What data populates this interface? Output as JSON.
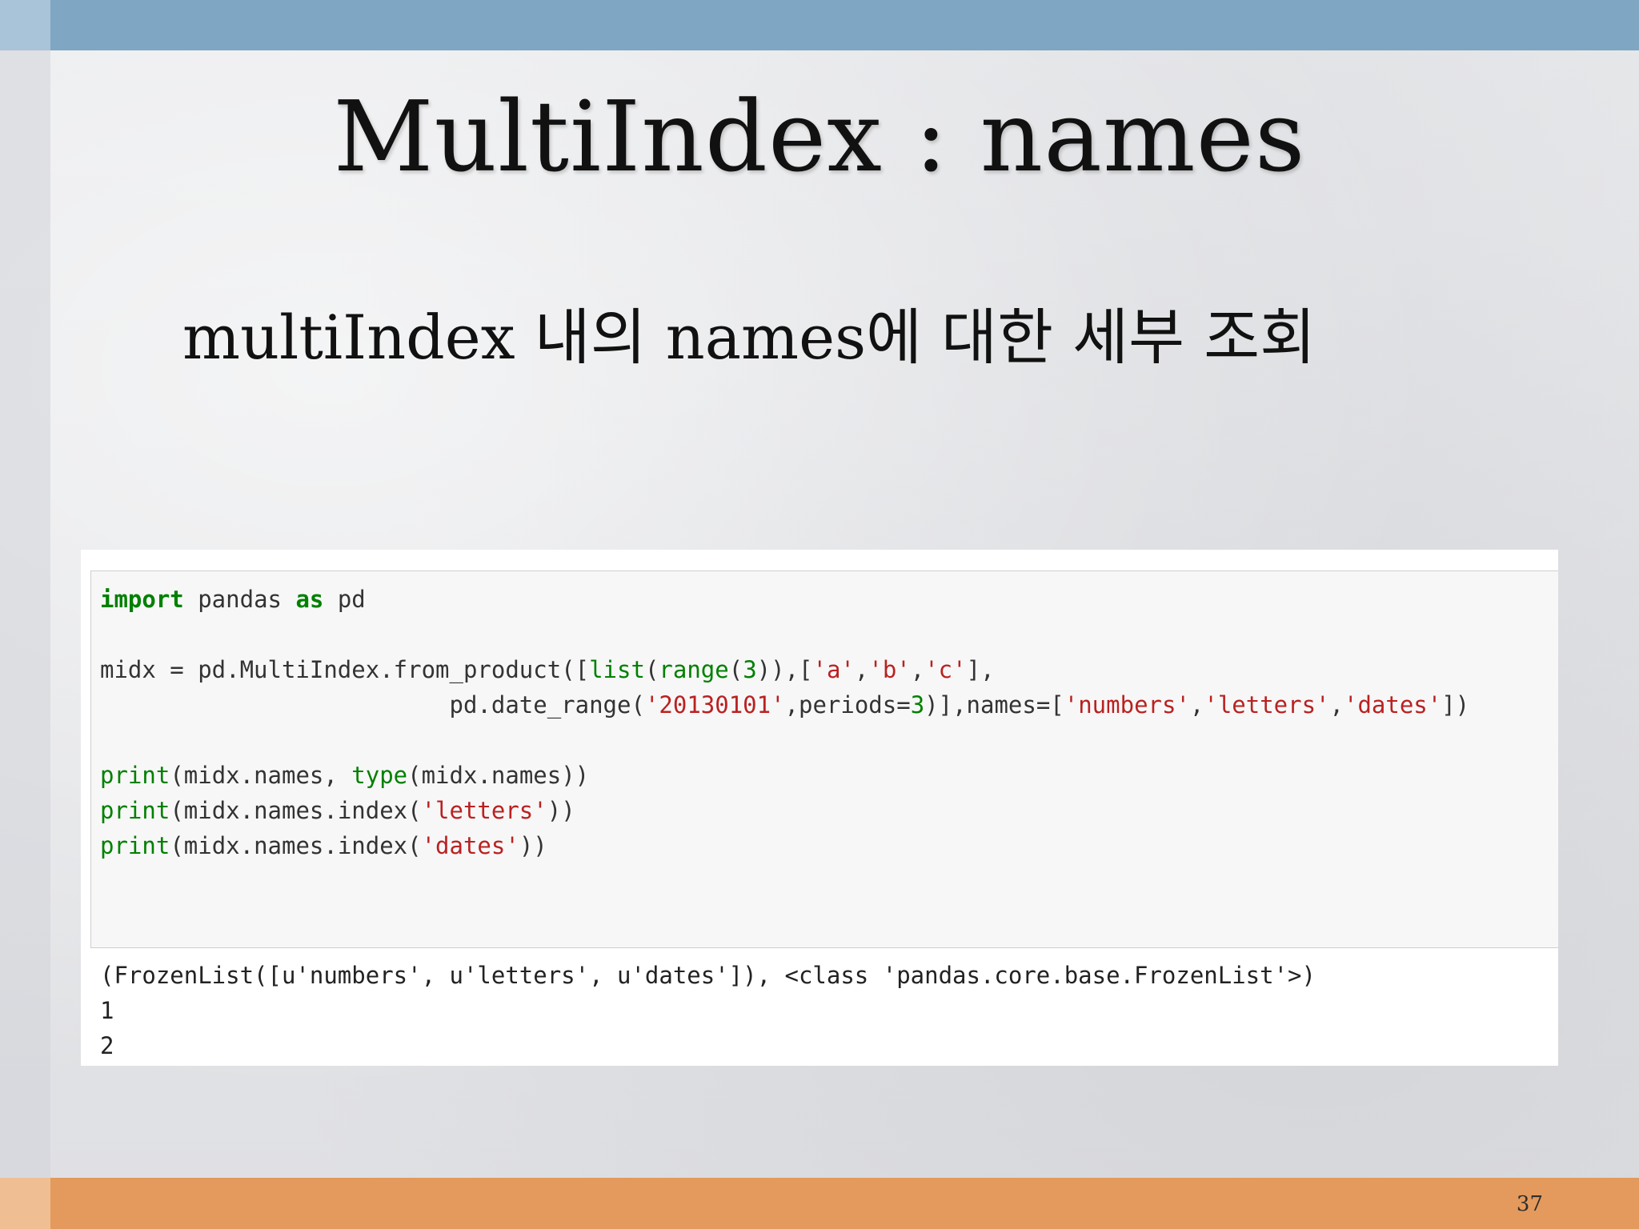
{
  "slide": {
    "title": "MultiIndex : names",
    "subtitle": "multiIndex 내의 names에 대한 세부 조회",
    "page_number": "37"
  },
  "code_cell": {
    "line1": {
      "kw1": "import",
      "t1": " pandas ",
      "kw2": "as",
      "t2": " pd"
    },
    "line2": {
      "t1": "midx = pd.MultiIndex.from_product([",
      "b1": "list",
      "t2": "(",
      "b2": "range",
      "t3": "(",
      "n1": "3",
      "t4": ")),[",
      "s1": "'a'",
      "t5": ",",
      "s2": "'b'",
      "t6": ",",
      "s3": "'c'",
      "t7": "],"
    },
    "line3": {
      "indent": "                         ",
      "t1": "pd.date_range(",
      "s1": "'20130101'",
      "t2": ",periods=",
      "n1": "3",
      "t3": ")],names=[",
      "s2": "'numbers'",
      "t4": ",",
      "s3": "'letters'",
      "t5": ",",
      "s4": "'dates'",
      "t6": "])"
    },
    "line4": {
      "b1": "print",
      "t1": "(midx.names, ",
      "b2": "type",
      "t2": "(midx.names))"
    },
    "line5": {
      "b1": "print",
      "t1": "(midx.names.index(",
      "s1": "'letters'",
      "t2": "))"
    },
    "line6": {
      "b1": "print",
      "t1": "(midx.names.index(",
      "s1": "'dates'",
      "t2": "))"
    }
  },
  "output": {
    "line1": "(FrozenList([u'numbers', u'letters', u'dates']), <class 'pandas.core.base.FrozenList'>)",
    "line2": "1",
    "line3": "2"
  },
  "colors": {
    "top_bar": "#7fa6c2",
    "bottom_bar": "#e39a5c",
    "keyword": "#008000",
    "string": "#ba2121"
  }
}
